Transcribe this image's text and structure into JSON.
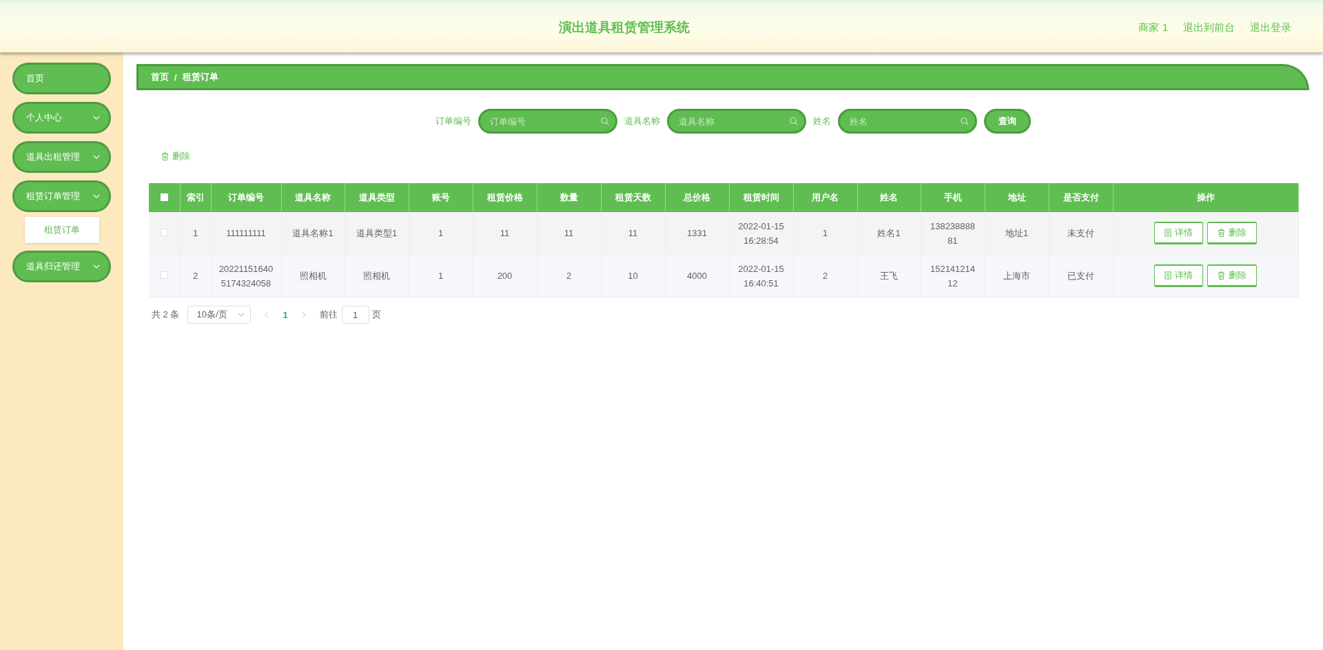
{
  "header": {
    "title": "演出道具租赁管理系统",
    "links": [
      "商家 1",
      "退出到前台",
      "退出登录"
    ]
  },
  "sidebar": {
    "items": [
      {
        "label": "首页",
        "kind": "link"
      },
      {
        "label": "个人中心",
        "kind": "group"
      },
      {
        "label": "道具出租管理",
        "kind": "group"
      },
      {
        "label": "租赁订单管理",
        "kind": "group",
        "children": [
          {
            "label": "租赁订单",
            "selected": true
          }
        ]
      },
      {
        "label": "道具归还管理",
        "kind": "group"
      }
    ]
  },
  "breadcrumb": [
    "首页",
    "/",
    "租赁订单"
  ],
  "search": {
    "fields": [
      {
        "label": "订单编号",
        "placeholder": "订单编号"
      },
      {
        "label": "道具名称",
        "placeholder": "道具名称"
      },
      {
        "label": "姓名",
        "placeholder": "姓名"
      }
    ],
    "button": "查询"
  },
  "toolbar": {
    "delete_button": "删除"
  },
  "table": {
    "select_all_checked": false,
    "columns": [
      "索引",
      "订单编号",
      "道具名称",
      "道具类型",
      "账号",
      "租赁价格",
      "数量",
      "租赁天数",
      "总价格",
      "租赁时间",
      "用户名",
      "姓名",
      "手机",
      "地址",
      "是否支付",
      "操作"
    ],
    "rows": [
      {
        "checked": false,
        "cells": [
          "1",
          "111111111",
          "道具名称1",
          "道具类型1",
          "1",
          "11",
          "11",
          "11",
          "1331",
          "2022-01-15 16:28:54",
          "1",
          "姓名1",
          "13823888881",
          "地址1",
          "未支付"
        ],
        "actions": [
          "详情",
          "删除"
        ]
      },
      {
        "checked": false,
        "cells": [
          "2",
          "202211516405174324058",
          "照相机",
          "照相机",
          "1",
          "200",
          "2",
          "10",
          "4000",
          "2022-01-15 16:40:51",
          "2",
          "王飞",
          "15214121412",
          "上海市",
          "已支付"
        ],
        "actions": [
          "详情",
          "删除"
        ]
      }
    ]
  },
  "pagination": {
    "total": "共 2 条",
    "page_size": "10条/页",
    "pages": [
      {
        "label": "1",
        "selected": true
      }
    ],
    "goto_label": "前往",
    "goto_value": "1",
    "goto_suffix": "页"
  }
}
